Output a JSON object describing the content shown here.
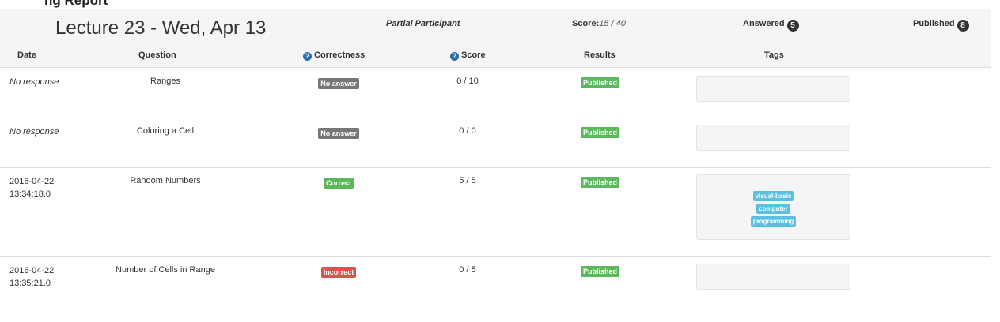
{
  "page": {
    "cut_heading": "ng Report"
  },
  "summary": {
    "lecture_title": "Lecture 23 - Wed, Apr 13",
    "participant": "Partial Participant",
    "score_label": "Score:",
    "score_value": "15 / 40",
    "answered_label": "Answered",
    "answered_count": "5",
    "published_label": "Published",
    "published_count": "8"
  },
  "table": {
    "headers": {
      "date": "Date",
      "question": "Question",
      "correctness": "Correctness",
      "score": "Score",
      "results": "Results",
      "tags": "Tags"
    },
    "rows": [
      {
        "date_line1": "No response",
        "date_line2": "",
        "question": "Ranges",
        "correctness": "No answer",
        "score": "0 / 10",
        "results": "Published",
        "tags": []
      },
      {
        "date_line1": "No response",
        "date_line2": "",
        "question": "Coloring a Cell",
        "correctness": "No answer",
        "score": "0 / 0",
        "results": "Published",
        "tags": []
      },
      {
        "date_line1": "2016-04-22",
        "date_line2": "13:34:18.0",
        "question": "Random Numbers",
        "correctness": "Correct",
        "score": "5 / 5",
        "results": "Published",
        "tags": [
          "visual-basic",
          "computer",
          "programming"
        ]
      },
      {
        "date_line1": "2016-04-22",
        "date_line2": "13:35:21.0",
        "question": "Number of Cells in Range",
        "correctness": "Incorrect",
        "score": "0 / 5",
        "results": "Published",
        "tags": []
      }
    ]
  },
  "icons": {
    "help": "question-circle-icon"
  },
  "colors": {
    "label_default": "#777777",
    "label_success": "#5cb85c",
    "label_danger": "#d9534f",
    "tag_info": "#5bc0de",
    "badge_dark": "#333333"
  }
}
